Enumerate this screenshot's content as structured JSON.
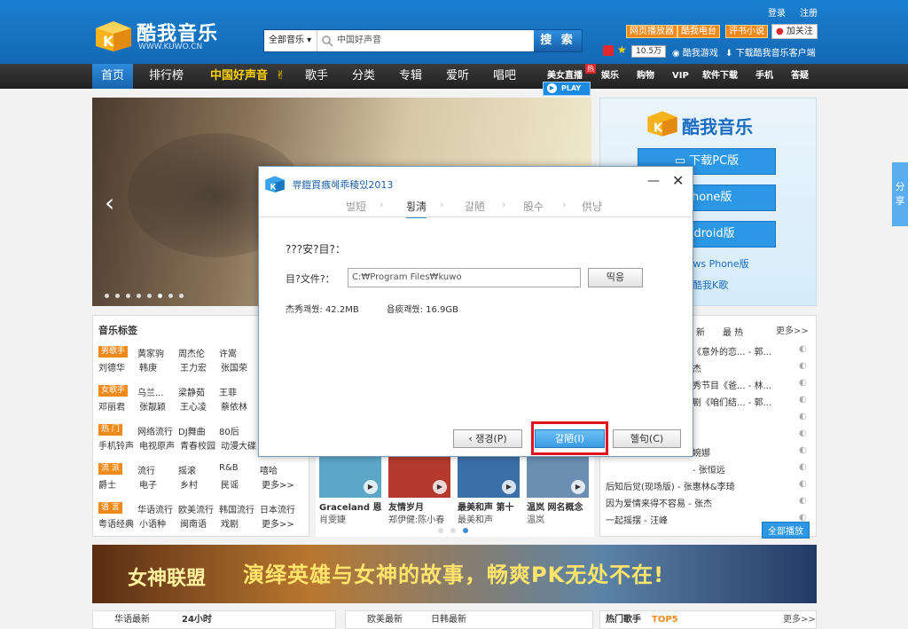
{
  "header": {
    "logo_text": "酷我音乐",
    "logo_url": "WWW.KUWO.CN",
    "login": "登录",
    "register": "注册",
    "search": {
      "category": "全部音乐",
      "placeholder": "中国好声音",
      "button": "搜 索"
    },
    "btns": [
      "网页播放器",
      "酷我电台",
      "评书小说"
    ],
    "follow": "加关注",
    "follower_count": "10.5万",
    "game": "酷我游戏",
    "download": "下载酷我音乐客户端"
  },
  "nav": {
    "items": [
      "首页",
      "排行榜",
      "中国好声音",
      "歌手",
      "分类",
      "专辑",
      "爱听",
      "唱吧"
    ],
    "extra": "美女直播",
    "hot_badge": "热",
    "right": [
      "娱乐",
      "购物",
      "VIP",
      "软件下载",
      "手机",
      "答疑"
    ],
    "play": "PLAY"
  },
  "side_box": {
    "title": "酷我音乐",
    "buttons": [
      "下载PC版",
      "iPhone版",
      "Android版"
    ],
    "links": [
      "Windows Phone版",
      "酷我K歌"
    ]
  },
  "tags": {
    "title": "音乐标签",
    "rows": [
      {
        "badge": "男歌手",
        "line1": [
          "黄家驹",
          "周杰伦",
          "许嵩"
        ],
        "line2": [
          "刘德华",
          "韩庚",
          "王力宏",
          "张国荣"
        ]
      },
      {
        "badge": "女歌手",
        "line1": [
          "乌兰...",
          "梁静茹",
          "王菲"
        ],
        "line2": [
          "邓丽君",
          "张靓颖",
          "王心凌",
          "蔡依林"
        ]
      },
      {
        "badge": "热 门",
        "line1": [
          "网络流行",
          "DJ舞曲",
          "80后"
        ],
        "line2": [
          "手机铃声",
          "电视原声",
          "青春校园",
          "动漫大碟"
        ]
      },
      {
        "badge": "流 派",
        "line1": [
          "流行",
          "摇滚",
          "R&B",
          "嘻哈"
        ],
        "line2": [
          "爵士",
          "电子",
          "乡村",
          "民谣",
          "更多>>"
        ]
      },
      {
        "badge": "语 言",
        "line1": [
          "华语流行",
          "欧美流行",
          "韩国流行",
          "日本流行"
        ],
        "line2": [
          "粤语经典",
          "小语种",
          "闽南语",
          "戏剧",
          "更多>>"
        ]
      }
    ]
  },
  "mid": {
    "albums": [
      {
        "title": "Graceland 恩",
        "artist": "肖雯婕"
      },
      {
        "title": "友情岁月",
        "artist": "郑伊健:陈小春"
      },
      {
        "title": "最美和声 第十",
        "artist": "最美和声"
      },
      {
        "title": "温岚 网名概念",
        "artist": "温岚"
      }
    ]
  },
  "right": {
    "tabs": [
      "新",
      "最 热",
      "更多>>"
    ],
    "items": [
      "《意外的恋... - 郭...",
      "杰",
      "秀节目《爸... - 林...",
      "剧《咱们结... - 郭...",
      "",
      "",
      "婉娜",
      "- 张恒远",
      "后知后觉(现场版) - 张惠林&李琦",
      "因为爱情来得不容易 - 张杰",
      "一起摇摆 - 汪峰"
    ],
    "play_all": "全部播放"
  },
  "game_banner": {
    "game_name": "女神联盟",
    "slogan": "演绎英雄与女神的故事，畅爽PK无处不在!"
  },
  "bottom": {
    "tab1": "华语最新",
    "tab2": "24小时",
    "tab3": "欧美最新",
    "tab4": "日韩最新",
    "tab5": "热门歌手",
    "tab5_suffix": "TOP5",
    "more": "更多>>"
  },
  "sidetab": "分享",
  "dialog": {
    "title": "쀼鎧買瘯혜乖稜있2013",
    "steps": [
      "벌短",
      "휭淸",
      "갈陋",
      "股수",
      "供냥"
    ],
    "heading": "???安?目?：",
    "dir_label": "目?文件?：",
    "dir_value": "C:₩Program Files₩kuwo",
    "browse": "띡응",
    "space_need": "杰秀쾌쒔: 42.2MB",
    "space_free": "욥痰쾌쒔: 16.9GB",
    "back": "쟁경(P)",
    "install": "갈陋(I)",
    "cancel": "혤句(C)"
  }
}
